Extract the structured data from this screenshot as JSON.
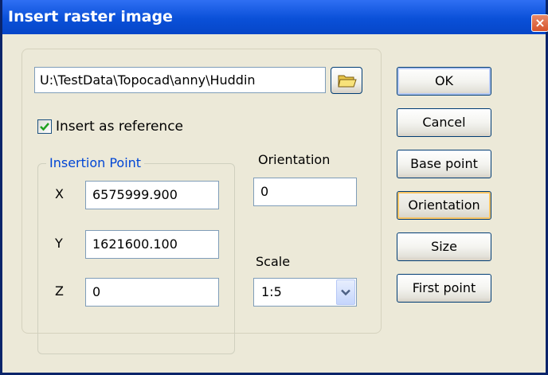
{
  "window": {
    "title": "Insert raster image",
    "close_glyph": "×"
  },
  "file": {
    "path_value": "U:\\TestData\\Topocad\\anny\\Huddin",
    "browse_icon": "folder-icon"
  },
  "options": {
    "insert_as_reference_label": "Insert as reference",
    "insert_as_reference_checked": true
  },
  "insertion_point": {
    "legend": "Insertion Point",
    "x_label": "X",
    "x_value": "6575999.900",
    "y_label": "Y",
    "y_value": "1621600.100",
    "z_label": "Z",
    "z_value": "0"
  },
  "orientation": {
    "label": "Orientation",
    "value": "0"
  },
  "scale": {
    "label": "Scale",
    "selected": "1:5"
  },
  "buttons": {
    "ok": "OK",
    "cancel": "Cancel",
    "base_point": "Base point",
    "orientation": "Orientation",
    "size": "Size",
    "first_point": "First point"
  },
  "colors": {
    "titlebar": "#0A50D8",
    "legend_text": "#0046D5",
    "dialog_bg": "#ECE9D8",
    "checkmark": "#21A121"
  }
}
